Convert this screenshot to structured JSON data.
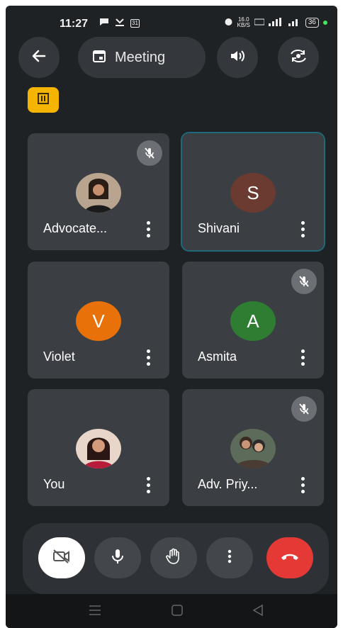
{
  "status_bar": {
    "time": "11:27",
    "calendar_day": "31",
    "net_speed_top": "16.0",
    "net_speed_bottom": "KB/S",
    "battery": "36"
  },
  "top_bar": {
    "meeting_title": "Meeting"
  },
  "participants": [
    {
      "name": "Advocate...",
      "muted": true,
      "avatar": "photo"
    },
    {
      "name": "Shivani",
      "muted": false,
      "avatar_letter": "S",
      "avatar_color": "#6b3a31",
      "active": true
    },
    {
      "name": "Violet",
      "muted": false,
      "avatar_letter": "V",
      "avatar_color": "#e8710a"
    },
    {
      "name": "Asmita",
      "muted": true,
      "avatar_letter": "A",
      "avatar_color": "#2e7d32"
    },
    {
      "name": "You",
      "muted": false,
      "avatar": "photo"
    },
    {
      "name": "Adv. Priy...",
      "muted": true,
      "avatar": "photo"
    }
  ],
  "colors": {
    "background": "#1f2225",
    "tile": "#3b3f43",
    "end_call": "#e53935",
    "badge": "#f4b400"
  }
}
